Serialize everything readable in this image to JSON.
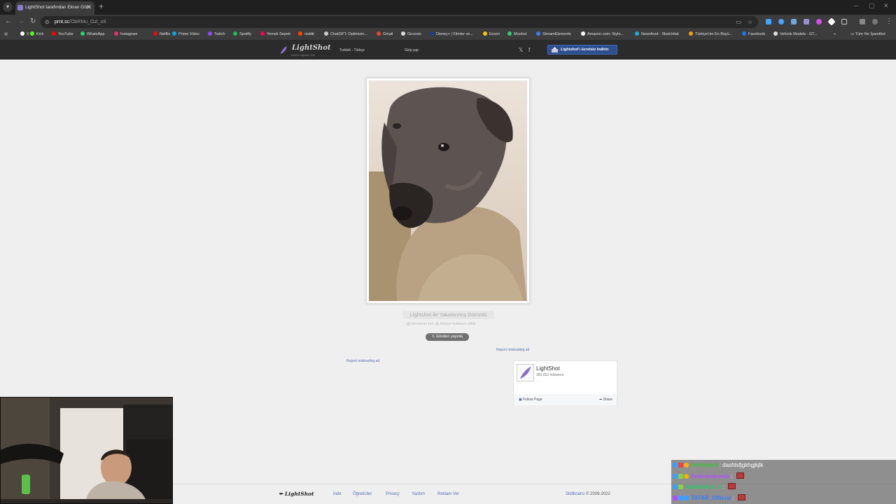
{
  "browser": {
    "tab_title": "LightShot tarafından Ekran Gör",
    "tab_close": "✕",
    "new_tab": "+",
    "url_host": "prnt.sc",
    "url_path": "/ObRMu_Ozt_o9",
    "bookmarks": [
      {
        "label": "X",
        "color": "#ffffff"
      },
      {
        "label": "Kick",
        "color": "#53fc18"
      },
      {
        "label": "YouTube",
        "color": "#ff0000"
      },
      {
        "label": "WhatsApp",
        "color": "#25d366"
      },
      {
        "label": "Instagram",
        "color": "#e1306c"
      },
      {
        "label": "Netflix",
        "color": "#e50914"
      },
      {
        "label": "Prime Video",
        "color": "#00a8e1"
      },
      {
        "label": "Twitch",
        "color": "#9146ff"
      },
      {
        "label": "Spotify",
        "color": "#1db954"
      },
      {
        "label": "Yemek Sepeti",
        "color": "#fa0050"
      },
      {
        "label": "reddit",
        "color": "#ff4500"
      },
      {
        "label": "ChatGPT: Optimizin...",
        "color": "#cccccc"
      },
      {
        "label": "Gmail",
        "color": "#ea4335"
      },
      {
        "label": "Gnoosic",
        "color": "#dddddd"
      },
      {
        "label": "Disney+ | Filmler ve...",
        "color": "#1f3c8f"
      },
      {
        "label": "Exxen",
        "color": "#f5c400"
      },
      {
        "label": "Moobot",
        "color": "#2ecc71"
      },
      {
        "label": "StreamElements",
        "color": "#3d7bf7"
      },
      {
        "label": "Amazon.com: Stylo...",
        "color": "#ffffff"
      },
      {
        "label": "Newsfeed - Sketchfab",
        "color": "#1caad9"
      },
      {
        "label": "Türkiye'nin En Büyü...",
        "color": "#f39c12"
      },
      {
        "label": "Facebook",
        "color": "#1877f2"
      },
      {
        "label": "Vehicle Models - GT...",
        "color": "#dddddd"
      }
    ],
    "bookmarks_more": "»",
    "all_bookmarks": "Tüm Yer İşaretleri"
  },
  "header": {
    "logo": "LightShot",
    "logo_sub": "screen capture tool",
    "language": "Turkish - Türkçe",
    "login": "Giriş yap",
    "download_button": "Lightshot'ı ücretsiz indirin"
  },
  "main": {
    "caption": "Lightshot ile Yakalanmış Görüntü",
    "similar": "benzerini bul",
    "copyright": "kötüye kullanım bildir",
    "tweet_button": "Gönderi yayınla",
    "report_ad": "Report misleading ad"
  },
  "facebook": {
    "page_name": "LightShot",
    "followers": "383,652 followers",
    "follow": "Follow Page",
    "share": "Share"
  },
  "footer": {
    "logo": "LightShot",
    "links": [
      "İndir",
      "Öğreticiler",
      "Privacy",
      "Yardım",
      "Reklam Ver"
    ],
    "company": "Skillbrains",
    "copyright": "© 2009-2022"
  },
  "chat": [
    {
      "user": "mdhsmnm",
      "message": "dasfdsfjgkhgjkjlk",
      "color": "#3fbf3f",
      "emote": false
    },
    {
      "user": "6vdrnlndevmb",
      "message": "",
      "color": "#b04dff",
      "emote": true
    },
    {
      "user": "hephaistos_6",
      "message": "",
      "color": "#27c96a",
      "emote": true
    },
    {
      "user": "TATAR_Official",
      "message": "",
      "color": "#3a7bff",
      "emote": true
    }
  ]
}
